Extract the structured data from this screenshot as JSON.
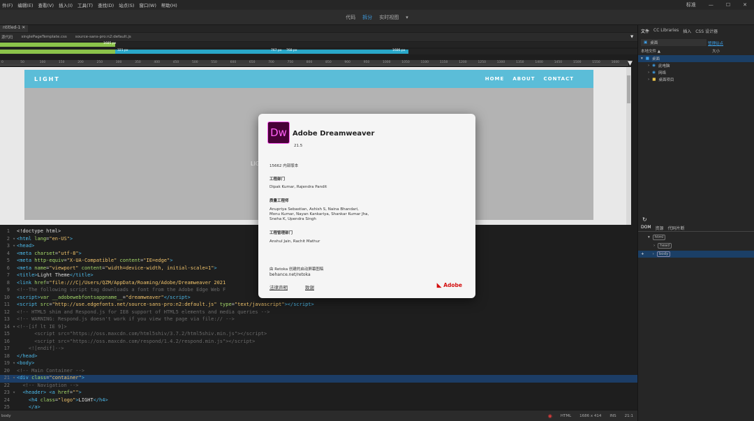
{
  "menu": [
    "件(F)",
    "编辑(E)",
    "查看(V)",
    "插入(I)",
    "工具(T)",
    "查找(D)",
    "站点(S)",
    "窗口(W)",
    "帮助(H)"
  ],
  "window": {
    "mode": "标准",
    "min": "—",
    "max": "☐",
    "close": "✕"
  },
  "view_tabs": {
    "code": "代码",
    "split": "拆分",
    "live": "实时视图",
    "dropdown": "▾"
  },
  "doc": {
    "tab": "ntitled-1",
    "close": "✕",
    "source": "源代码",
    "related": [
      "singlePageTemplate.css",
      "source-sans-pro:n2:default.js"
    ],
    "filter": "▼"
  },
  "mq": {
    "bar1": "1685 px",
    "bar2a": "321 px",
    "bar2b": "767 px",
    "bar2c": "768 px",
    "bar2d": "1686 px"
  },
  "ruler": [
    "0",
    "50",
    "100",
    "150",
    "200",
    "250",
    "300",
    "350",
    "400",
    "450",
    "500",
    "550",
    "600",
    "650",
    "700",
    "750",
    "800",
    "850",
    "900",
    "950",
    "1000",
    "1050",
    "1100",
    "1150",
    "1200",
    "1250",
    "1300",
    "1350",
    "1400",
    "1450",
    "1500",
    "1550",
    "1600",
    "1650"
  ],
  "site": {
    "logo": "LIGHT",
    "nav": [
      "HOME",
      "ABOUT",
      "CONTACT"
    ],
    "hero": "LIG"
  },
  "code": [
    {
      "n": "1",
      "html": "<span class='txt'>&lt;!doctype html&gt;</span>"
    },
    {
      "n": "2",
      "f": "▾",
      "html": "<span class='tag'>&lt;html</span> <span class='attr'>lang</span>=<span class='val'>\"en-US\"</span><span class='tag'>&gt;</span>"
    },
    {
      "n": "3",
      "f": "▾",
      "html": "<span class='tag'>&lt;head&gt;</span>"
    },
    {
      "n": "4",
      "html": "<span class='tag'>&lt;meta</span> <span class='attr'>charset</span>=<span class='val'>\"utf-8\"</span><span class='tag'>&gt;</span>"
    },
    {
      "n": "5",
      "html": "<span class='tag'>&lt;meta</span> <span class='attr'>http-equiv</span>=<span class='val'>\"X-UA-Compatible\"</span> <span class='attr'>content</span>=<span class='val'>\"IE=edge\"</span><span class='tag'>&gt;</span>"
    },
    {
      "n": "6",
      "html": "<span class='tag'>&lt;meta</span> <span class='attr'>name</span>=<span class='val'>\"viewport\"</span> <span class='attr'>content</span>=<span class='val'>\"width=device-width, initial-scale=1\"</span><span class='tag'>&gt;</span>"
    },
    {
      "n": "7",
      "html": "<span class='tag'>&lt;title&gt;</span><span class='txt'>Light Theme</span><span class='tag'>&lt;/title&gt;</span>"
    },
    {
      "n": "8",
      "html": "<span class='tag'>&lt;link</span> <span class='attr'>href</span>=<span class='val'>\"file:///C|/Users/QZM/AppData/Roaming/Adobe/Dreamweaver 2021                                          ate.css\"</span> <span class='attr'>rel</span>=<span class='val'>\"stylesheet\"</span> <span class='attr'>type</span>=<span class='val'>\"text/css\"</span><span class='tag'>&gt;</span>"
    },
    {
      "n": "9",
      "html": "<span class='cmt'>&lt;!--The following script tag downloads a font from the Adobe Edge Web F                                      o not modify it.--&gt;</span>"
    },
    {
      "n": "10",
      "html": "<span class='tag'>&lt;script&gt;</span><span class='attr'>var __adobewebfontsappname__</span>=<span class='val'>\"dreamweaver\"</span><span class='tag'>&lt;/script&gt;</span>"
    },
    {
      "n": "11",
      "html": "<span class='tag'>&lt;script</span> <span class='attr'>src</span>=<span class='val'>\"http://use.edgefonts.net/source-sans-pro:n2:default.js\"</span> <span class='attr'>type</span>=<span class='val'>\"text/javascript\"</span><span class='tag'>&gt;&lt;/script&gt;</span>"
    },
    {
      "n": "12",
      "html": "<span class='cmt'>&lt;!-- HTML5 shim and Respond.js for IE8 support of HTML5 elements and media queries --&gt;</span>"
    },
    {
      "n": "13",
      "html": "<span class='cmt'>&lt;!-- WARNING: Respond.js doesn't work if you view the page via file:// --&gt;</span>"
    },
    {
      "n": "14",
      "f": "▾",
      "html": "<span class='cmt'>&lt;!--[if lt IE 9]&gt;</span>"
    },
    {
      "n": "15",
      "html": "<span class='cmt'>      &lt;script src=\"https://oss.maxcdn.com/html5shiv/3.7.2/html5shiv.min.js\"&gt;&lt;/script&gt;</span>"
    },
    {
      "n": "16",
      "html": "<span class='cmt'>      &lt;script src=\"https://oss.maxcdn.com/respond/1.4.2/respond.min.js\"&gt;&lt;/script&gt;</span>"
    },
    {
      "n": "17",
      "html": "<span class='cmt'>    &lt;![endif]--&gt;</span>"
    },
    {
      "n": "18",
      "html": "<span class='tag'>&lt;/head&gt;</span>"
    },
    {
      "n": "19",
      "f": "▾",
      "html": "<span class='tag'>&lt;body&gt;</span>"
    },
    {
      "n": "20",
      "html": "<span class='cmt'>&lt;!-- Main Container --&gt;</span>"
    },
    {
      "n": "21",
      "f": "▾",
      "hl": true,
      "html": "<span class='tag'>&lt;div</span> <span class='attr'>class</span>=<span class='val'>\"container\"</span><span class='tag'>&gt;</span>"
    },
    {
      "n": "22",
      "html": "  <span class='cmt'>&lt;!-- Navigation --&gt;</span>"
    },
    {
      "n": "23",
      "f": "▾",
      "html": "  <span class='tag'>&lt;header&gt;</span> <span class='tag'>&lt;a</span> <span class='attr'>href</span>=<span class='val'>\"\"</span><span class='tag'>&gt;</span>"
    },
    {
      "n": "24",
      "html": "    <span class='tag'>&lt;h4</span> <span class='attr'>class</span>=<span class='val'>\"logo\"</span><span class='tag'>&gt;</span><span class='txt'>LIGHT</span><span class='tag'>&lt;/h4&gt;</span>"
    },
    {
      "n": "25",
      "html": "    <span class='tag'>&lt;/a&gt;</span>"
    }
  ],
  "status": {
    "left": "body",
    "lang": "HTML",
    "size": "1686 x 414",
    "ins": "INS",
    "pos": "21:1"
  },
  "rpanel": {
    "tabs": [
      "文件",
      "CC Libraries",
      "插入",
      "CSS 设计器"
    ],
    "site": "桌面",
    "manage": "管理站点",
    "col1": "本地文件 ▲",
    "col2": "大小",
    "tree": [
      "桌面",
      "此电脑",
      "网络",
      "桌面项目"
    ],
    "dom_tabs": [
      "DOM",
      "资源",
      "代码片断"
    ],
    "dom": [
      "html",
      "head",
      "body"
    ]
  },
  "about": {
    "app": "Adobe Dreamweaver",
    "icon": "Dw",
    "version": "21.5",
    "build": "15662 内部版本",
    "s1": "工程部门",
    "p1": "Dipak Kumar, Rajendra Pandit",
    "s2": "质量工程师",
    "p2a": "Anupriya Sebastian, Ashish S, Naina Bhandari,",
    "p2b": "Monu Kumar, Nayan Kankariya, Shankar Kumar Jha,",
    "p2c": "Sneha K, Upendra Singh",
    "s3": "工程管理部门",
    "p3": "Anshul Jain, Rachit Mathur",
    "credit": "由 Retoka 创建的启动屏幕图稿",
    "credit_url": "behance.net/retoka",
    "legal": "法律声明",
    "thanks": "致谢",
    "brand": "Adobe"
  }
}
